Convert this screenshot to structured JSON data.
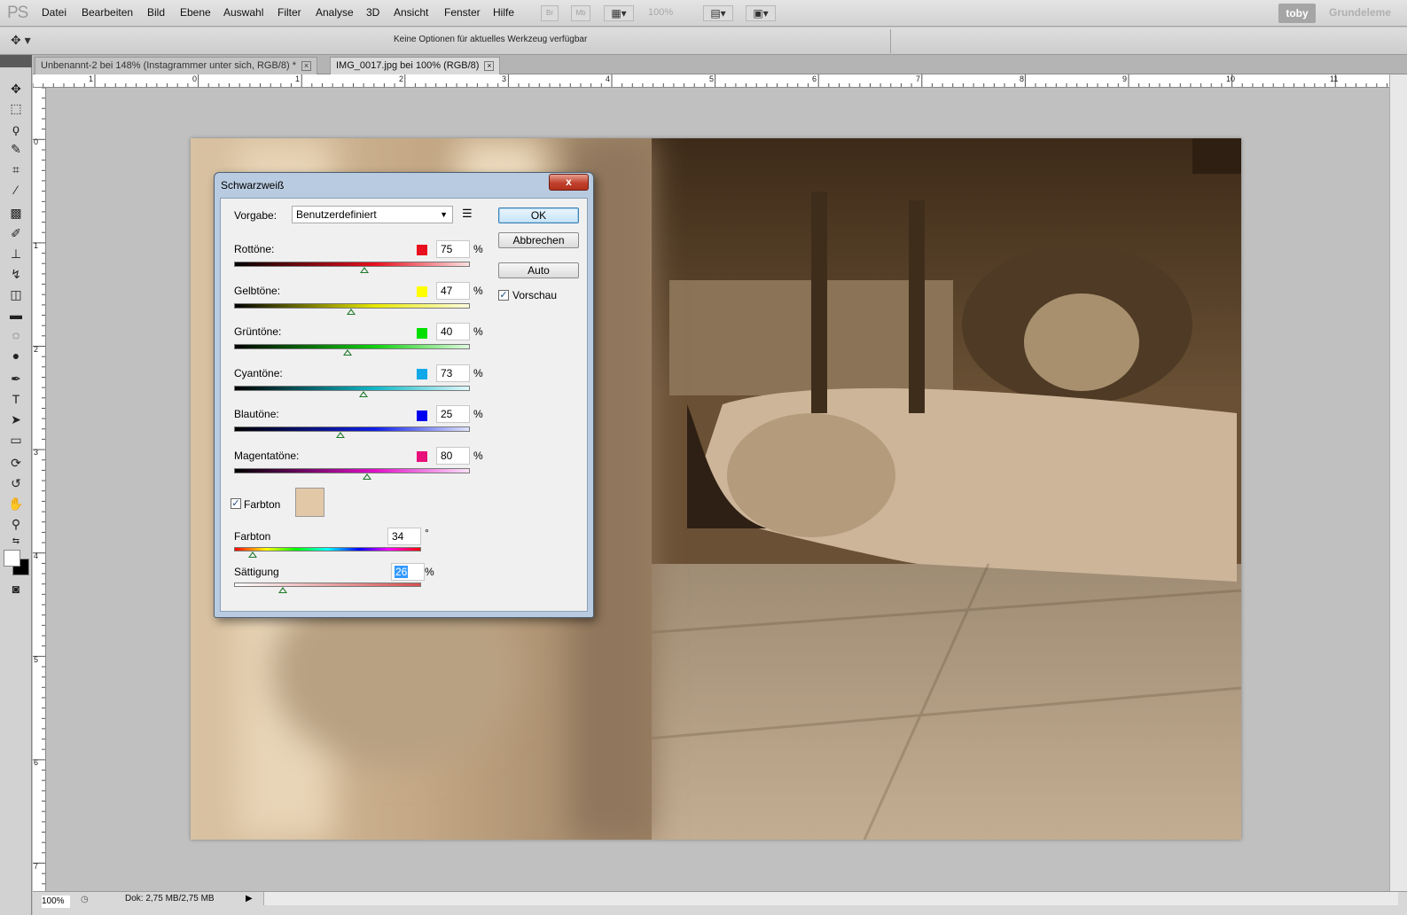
{
  "app": {
    "logo": "PS"
  },
  "menu": [
    "Datei",
    "Bearbeiten",
    "Bild",
    "Ebene",
    "Auswahl",
    "Filter",
    "Analyse",
    "3D",
    "Ansicht",
    "Fenster",
    "Hilfe"
  ],
  "menubar": {
    "bridge_label": "Br",
    "minibridge_label": "Mb",
    "zoom_level": "100%",
    "user": "toby",
    "workspace": "Grundeleme"
  },
  "options": {
    "message": "Keine Optionen für aktuelles Werkzeug verfügbar"
  },
  "tabs": [
    {
      "label": "Unbenannt-2 bei 148% (Instagrammer unter sich, RGB/8) *",
      "active": false
    },
    {
      "label": "IMG_0017.jpg bei 100% (RGB/8)",
      "active": true
    }
  ],
  "ruler": {
    "top_labels": [
      "1",
      "0",
      "1",
      "2",
      "3",
      "4",
      "5",
      "6",
      "7",
      "8",
      "9",
      "10",
      "11"
    ],
    "left_labels": [
      "0",
      "1",
      "2",
      "3",
      "4",
      "5",
      "6",
      "7"
    ]
  },
  "dialog": {
    "title": "Schwarzweiß",
    "close_symbol": "x",
    "preset_label": "Vorgabe:",
    "preset_value": "Benutzerdefiniert",
    "buttons": {
      "ok": "OK",
      "cancel": "Abbrechen",
      "auto": "Auto"
    },
    "preview": {
      "label": "Vorschau",
      "checked": true
    },
    "channels": [
      {
        "label": "Rottöne:",
        "value": "75",
        "unit": "%",
        "color": "#e8101e"
      },
      {
        "label": "Gelbtöne:",
        "value": "47",
        "unit": "%",
        "color": "#ffff00"
      },
      {
        "label": "Grüntöne:",
        "value": "40",
        "unit": "%",
        "color": "#00e000"
      },
      {
        "label": "Cyantöne:",
        "value": "73",
        "unit": "%",
        "color": "#10a8e8"
      },
      {
        "label": "Blautöne:",
        "value": "25",
        "unit": "%",
        "color": "#0000f0"
      },
      {
        "label": "Magentatöne:",
        "value": "80",
        "unit": "%",
        "color": "#e8107a"
      }
    ],
    "tint": {
      "label": "Farbton",
      "checked": true,
      "swatch_color": "#e3c8a8"
    },
    "hue": {
      "label": "Farbton",
      "value": "34",
      "unit": "°"
    },
    "saturation": {
      "label": "Sättigung",
      "value": "26",
      "unit": "%"
    }
  },
  "status": {
    "zoom": "100%",
    "doc": "Dok: 2,75 MB/2,75 MB"
  }
}
